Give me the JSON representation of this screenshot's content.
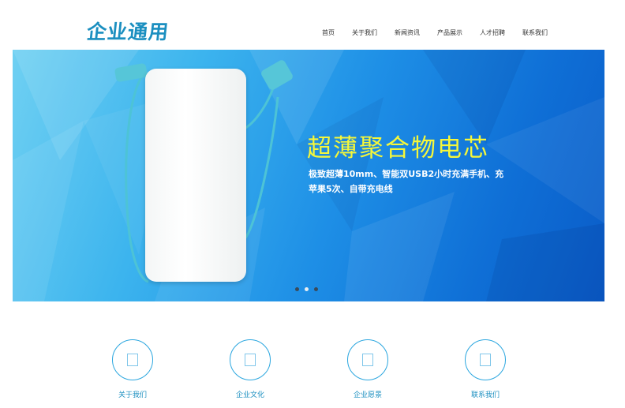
{
  "header": {
    "logo_text": "企业通用",
    "nav": [
      "首页",
      "关于我们",
      "新闻资讯",
      "产品展示",
      "人才招聘",
      "联系我们"
    ]
  },
  "banner": {
    "title": "超薄聚合物电芯",
    "subtitle": "极致超薄10mm、智能双USB2小时充满手机、充苹果5次、自带充电线",
    "slide_count": 3,
    "active_slide": 2
  },
  "features": [
    {
      "label": "关于我们",
      "icon": "placeholder-icon"
    },
    {
      "label": "企业文化",
      "icon": "placeholder-icon"
    },
    {
      "label": "企业愿景",
      "icon": "placeholder-icon"
    },
    {
      "label": "联系我们",
      "icon": "placeholder-icon"
    }
  ],
  "colors": {
    "accent": "#1b8fc0",
    "banner_title": "#f5f73a",
    "circle_border": "#2aa6df"
  }
}
